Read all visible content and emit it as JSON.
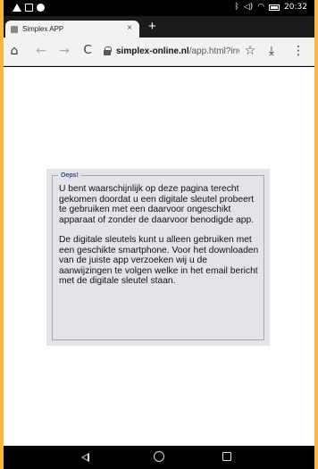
{
  "status_bar": {
    "time": "20:32",
    "left_icons": [
      "warning-icon",
      "screen-icon",
      "chrome-icon"
    ],
    "right_icons": [
      "bluetooth-icon",
      "mute-icon",
      "wifi-icon",
      "battery-icon"
    ]
  },
  "browser": {
    "tab_title": "Simplex APP",
    "tab_close": "×",
    "new_tab": "+",
    "url_host": "simplex-online.nl",
    "url_path": "/app.html?invi",
    "buttons": {
      "home": "⌂",
      "back": "←",
      "forward": "→",
      "reload": "C",
      "star": "☆",
      "download": "⤓",
      "menu": "⋮"
    }
  },
  "dialog": {
    "legend": "Oeps!",
    "paragraph_1": "U bent waarschijnlijk op deze pagina terecht gekomen doordat u een digitale sleutel probeert te gebruiken met een daarvoor ongeschikt apparaat of zonder de daarvoor benodigde app.",
    "paragraph_2": "De digitale sleutels kunt u alleen gebruiken met een geschikte smartphone. Voor het downloaden van de juiste app verzoeken wij u de aanwijzingen te volgen welke in het email bericht met de digitale sleutel staan."
  },
  "colors": {
    "card_background": "#e3e3e9",
    "legend_color": "#2f4a80",
    "device_edge": "#f6b73c"
  }
}
